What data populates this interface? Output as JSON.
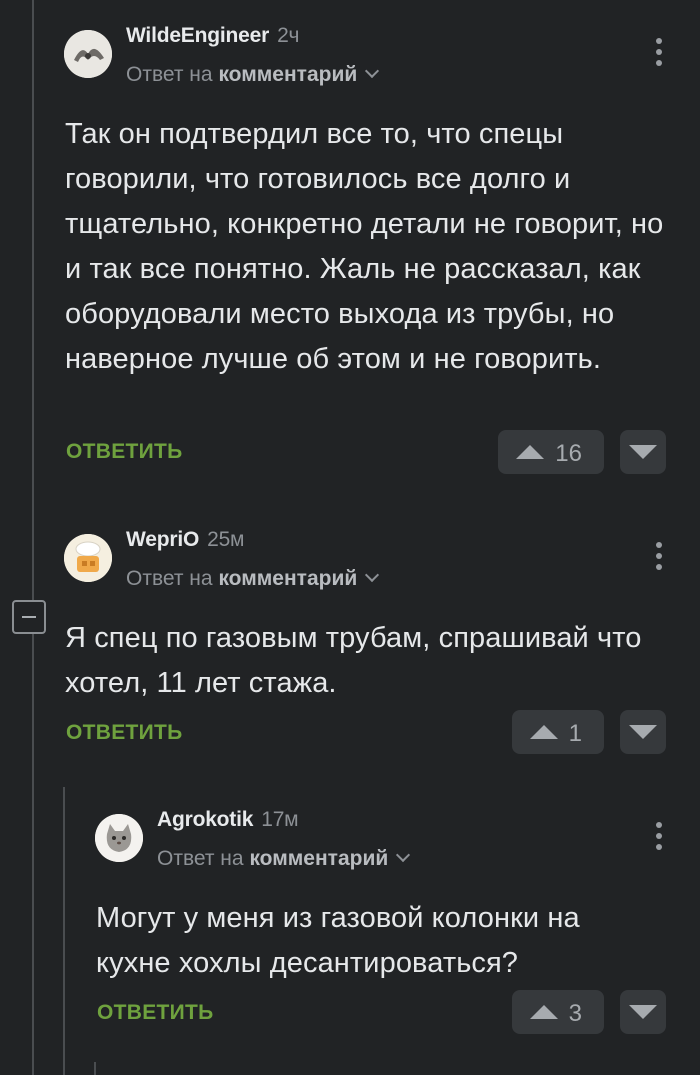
{
  "comments": [
    {
      "author": "WildeEngineer",
      "time": "2ч",
      "reply_prefix": "Ответ на",
      "reply_target": "комментарий",
      "text": "Так он подтвердил все то, что спецы говорили, что готовилось все долго и тщательно, конкретно детали не говорит, но и так все понятно. Жаль не рассказал, как оборудовали место выхода из трубы, но наверное лучше об этом и не говорить.",
      "reply_label": "ОТВЕТИТЬ",
      "votes": "16"
    },
    {
      "author": "WepriO",
      "time": "25м",
      "reply_prefix": "Ответ на",
      "reply_target": "комментарий",
      "text": "Я спец по газовым трубам, спрашивай что хотел, 11 лет стажа.",
      "reply_label": "ОТВЕТИТЬ",
      "votes": "1"
    },
    {
      "author": "Agrokotik",
      "time": "17м",
      "reply_prefix": "Ответ на",
      "reply_target": "комментарий",
      "text": "Могут у меня из газовой колонки на кухне хохлы десантироваться?",
      "reply_label": "ОТВЕТИТЬ",
      "votes": "3"
    }
  ],
  "icons": {
    "upvote": "triangle-up-icon",
    "downvote": "triangle-down-icon",
    "more": "vertical-dots-icon",
    "collapse": "minus-square-icon"
  },
  "colors": {
    "background": "#212325",
    "reply_button": "#6fa23e",
    "vote_bg": "#36393c"
  }
}
